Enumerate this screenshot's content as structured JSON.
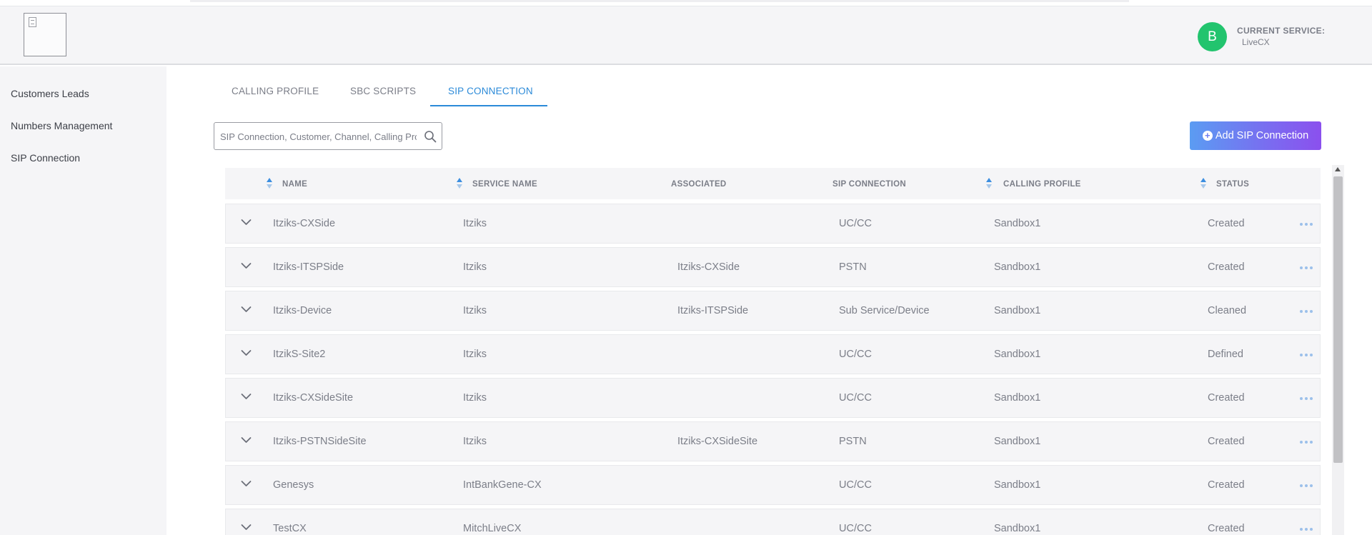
{
  "header": {
    "avatar_initial": "B",
    "current_service_label": "CURRENT SERVICE:",
    "current_service_value": "LiveCX"
  },
  "sidebar": {
    "items": [
      {
        "label": "Customers Leads"
      },
      {
        "label": "Numbers Management"
      },
      {
        "label": "SIP Connection"
      }
    ]
  },
  "tabs": [
    {
      "label": "CALLING PROFILE",
      "active": false
    },
    {
      "label": "SBC SCRIPTS",
      "active": false
    },
    {
      "label": "SIP CONNECTION",
      "active": true
    }
  ],
  "search": {
    "placeholder": "SIP Connection, Customer, Channel, Calling Profile",
    "value": ""
  },
  "add_button": {
    "label": "Add SIP Connection"
  },
  "table": {
    "columns": [
      {
        "label": "NAME",
        "sortable": true
      },
      {
        "label": "SERVICE NAME",
        "sortable": true
      },
      {
        "label": "ASSOCIATED",
        "sortable": false
      },
      {
        "label": "SIP CONNECTION",
        "sortable": false
      },
      {
        "label": "CALLING PROFILE",
        "sortable": true
      },
      {
        "label": "STATUS",
        "sortable": true
      }
    ],
    "rows": [
      {
        "name": "Itziks-CXSide",
        "service": "Itziks",
        "associated": "",
        "sip": "UC/CC",
        "profile": "Sandbox1",
        "status": "Created"
      },
      {
        "name": "Itziks-ITSPSide",
        "service": "Itziks",
        "associated": "Itziks-CXSide",
        "sip": "PSTN",
        "profile": "Sandbox1",
        "status": "Created"
      },
      {
        "name": "Itziks-Device",
        "service": "Itziks",
        "associated": "Itziks-ITSPSide",
        "sip": "Sub Service/Device",
        "profile": "Sandbox1",
        "status": "Cleaned"
      },
      {
        "name": "ItzikS-Site2",
        "service": "Itziks",
        "associated": "",
        "sip": "UC/CC",
        "profile": "Sandbox1",
        "status": "Defined"
      },
      {
        "name": "Itziks-CXSideSite",
        "service": "Itziks",
        "associated": "",
        "sip": "UC/CC",
        "profile": "Sandbox1",
        "status": "Created"
      },
      {
        "name": "Itziks-PSTNSideSite",
        "service": "Itziks",
        "associated": "Itziks-CXSideSite",
        "sip": "PSTN",
        "profile": "Sandbox1",
        "status": "Created"
      },
      {
        "name": "Genesys",
        "service": "IntBankGene-CX",
        "associated": "",
        "sip": "UC/CC",
        "profile": "Sandbox1",
        "status": "Created"
      },
      {
        "name": "TestCX",
        "service": "MitchLiveCX",
        "associated": "",
        "sip": "UC/CC",
        "profile": "Sandbox1",
        "status": "Created"
      }
    ]
  },
  "colors": {
    "accent": "#2b8ad8",
    "avatar": "#22c46e",
    "button_gradient_start": "#5b9cf2",
    "button_gradient_end": "#8b50ee"
  }
}
